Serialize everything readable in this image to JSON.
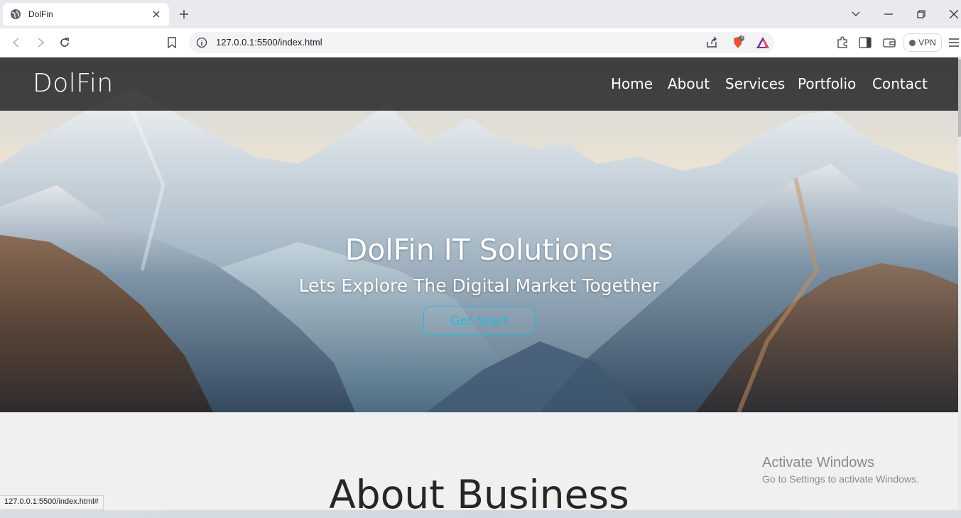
{
  "browser": {
    "tab": {
      "title": "DolFin",
      "favicon": "globe-icon"
    },
    "address": {
      "url": "127.0.0.1:5500/index.html"
    },
    "vpn_label": "VPN",
    "brave_badge": "1",
    "status_url": "127.0.0.1:5500/index.html#"
  },
  "site": {
    "logo": "DolFin",
    "nav": [
      {
        "label": "Home"
      },
      {
        "label": "About"
      },
      {
        "label": "Services"
      },
      {
        "label": "Portfolio"
      },
      {
        "label": "Contact"
      }
    ],
    "hero": {
      "title": "DolFin IT Solutions",
      "subtitle": "Lets Explore The Digital Market Together",
      "cta": "Get Start"
    },
    "about_title": "About Business"
  },
  "os": {
    "activate_title": "Activate Windows",
    "activate_sub": "Go to Settings to activate Windows."
  },
  "colors": {
    "accent": "#2ab7d9",
    "navbar": "#141414",
    "page_bg": "#f0f0f0",
    "text_dark": "#262626"
  }
}
